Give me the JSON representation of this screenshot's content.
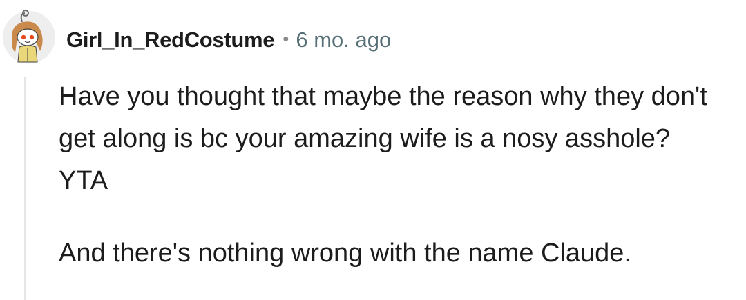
{
  "comment": {
    "author": "Girl_In_RedCostume",
    "separator": "•",
    "timestamp": "6 mo. ago",
    "avatar_icon": "reddit-snoo-avatar-icon",
    "body": [
      "Have you thought that maybe the reason why they don't get along is bc your amazing wife is a nosy asshole? YTA",
      "And there's nothing wrong with the name Claude."
    ]
  },
  "colors": {
    "text": "#1c1c1c",
    "meta": "#576f76",
    "thread_line": "#e5e5e5",
    "background": "#ffffff"
  }
}
